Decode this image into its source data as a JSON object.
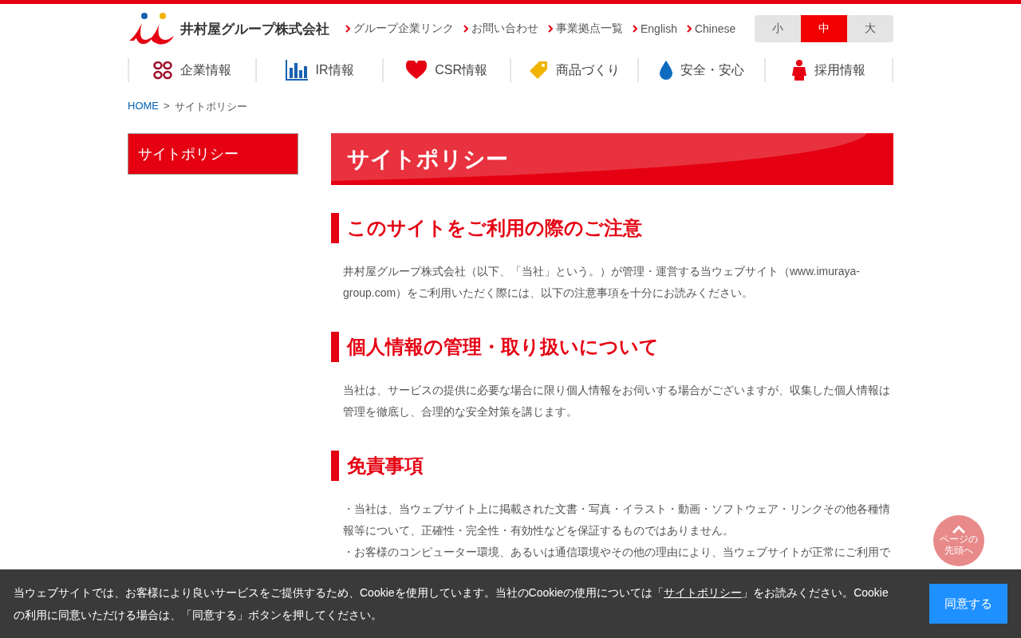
{
  "logo": {
    "name": "井村屋グループ株式会社"
  },
  "header_links": [
    "グループ企業リンク",
    "お問い合わせ",
    "事業拠点一覧",
    "English",
    "Chinese"
  ],
  "font_size": [
    {
      "label": "小",
      "selected": false
    },
    {
      "label": "中",
      "selected": true
    },
    {
      "label": "大",
      "selected": false
    }
  ],
  "nav": [
    {
      "label": "企業情報",
      "kind": "dots"
    },
    {
      "label": "IR情報",
      "kind": "bars"
    },
    {
      "label": "CSR情報",
      "kind": "heart"
    },
    {
      "label": "商品づくり",
      "kind": "tag"
    },
    {
      "label": "安全・安心",
      "kind": "drop"
    },
    {
      "label": "採用情報",
      "kind": "person"
    }
  ],
  "breadcrumb": {
    "separator": ">",
    "items": [
      {
        "label": "HOME",
        "kind": "link"
      },
      {
        "label": "サイトポリシー",
        "kind": "current"
      }
    ]
  },
  "sidebar": {
    "items": [
      {
        "label": "サイトポリシー",
        "selected": true
      }
    ]
  },
  "page_title": "サイトポリシー",
  "sections": [
    {
      "heading": "このサイトをご利用の際のご注意",
      "paragraphs": [
        "井村屋グループ株式会社（以下、「当社」という。）が管理・運営する当ウェブサイト（www.imuraya-group.com）をご利用いただく際には、以下の注意事項を十分にお読みください。"
      ]
    },
    {
      "heading": "個人情報の管理・取り扱いについて",
      "paragraphs": [
        "当社は、サービスの提供に必要な場合に限り個人情報をお伺いする場合がございますが、収集した個人情報は管理を徹底し、合理的な安全対策を講じます。"
      ]
    },
    {
      "heading": "免責事項",
      "paragraphs": [
        "・当社は、当ウェブサイト上に掲載された文書・写真・イラスト・動画・ソフトウェア・リンクその他各種情報等について、正確性・完全性・有効性などを保証するものではありません。",
        "・お客様のコンピューター環境、あるいは通信環境やその他の理由により、当ウェブサイトが正常にご利用で"
      ]
    }
  ],
  "page_top": {
    "label": "ページの先頭へ"
  },
  "cookie_banner": {
    "text_before": "当ウェブサイトでは、お客様により良いサービスをご提供するため、Cookieを使用しています。当社のCookieの使用については「",
    "link": "サイトポリシー",
    "text_after": "」をお読みください。Cookieの利用に同意いただける場合は、「同意する」ボタンを押してください。",
    "button": "同意する"
  }
}
